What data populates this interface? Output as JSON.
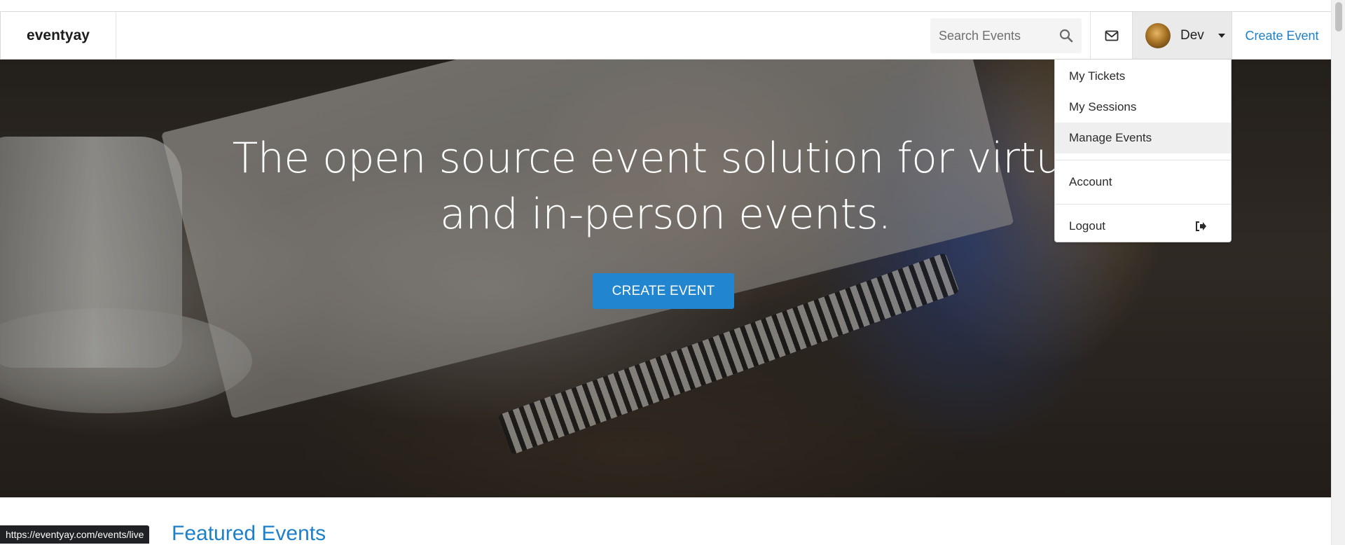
{
  "navbar": {
    "brand": "eventyay",
    "search": {
      "placeholder": "Search Events",
      "value": ""
    },
    "user": {
      "name": "Dev"
    },
    "create_event_link": "Create Event"
  },
  "hero": {
    "title": "The open source event solution for virtual and in-person events.",
    "button": "CREATE EVENT"
  },
  "user_menu": {
    "items": [
      {
        "label": "My Tickets"
      },
      {
        "label": "My Sessions"
      },
      {
        "label": "Manage Events"
      },
      {
        "label": "Account"
      },
      {
        "label": "Logout"
      }
    ]
  },
  "section": {
    "featured_title": "Featured Events"
  },
  "status_bar": {
    "url": "https://eventyay.com/events/live"
  },
  "colors": {
    "accent": "#2185d0",
    "link": "#1d80cb",
    "active_menu_bg": "#efefef"
  },
  "icons": [
    "search-icon",
    "mail-icon",
    "caret-down-icon",
    "logout-icon",
    "avatar"
  ]
}
